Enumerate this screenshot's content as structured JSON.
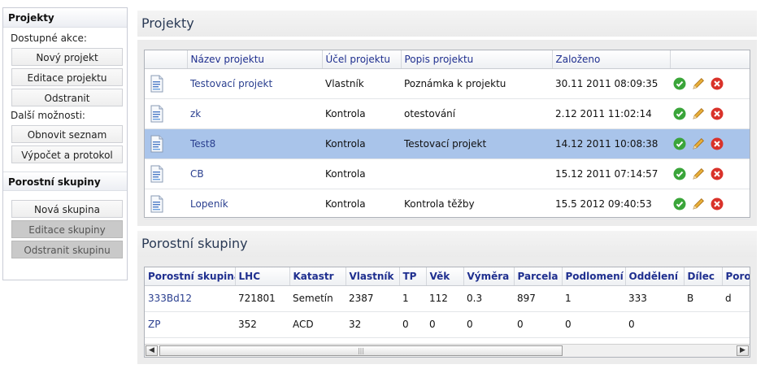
{
  "sidebar": {
    "section1_title": "Projekty",
    "available_actions_label": "Dostupné akce:",
    "btn_new_project": "Nový projekt",
    "btn_edit_project": "Editace projektu",
    "btn_remove": "Odstranit",
    "more_options_label": "Další možnosti:",
    "btn_refresh_list": "Obnovit seznam",
    "btn_calc_protocol": "Výpočet a protokol",
    "section2_title": "Porostní skupiny",
    "btn_new_group": "Nová skupina",
    "btn_edit_group": "Editace skupiny",
    "btn_remove_group": "Odstranit skupinu"
  },
  "projects": {
    "title": "Projekty",
    "columns": [
      "Název projektu",
      "Účel projektu",
      "Popis projektu",
      "Založeno"
    ],
    "rows": [
      {
        "name": "Testovací projekt",
        "purpose": "Vlastník",
        "description": "Poznámka k projektu",
        "created": "30.11 2011 08:09:35"
      },
      {
        "name": "zk",
        "purpose": "Kontrola",
        "description": "otestování",
        "created": "2.12 2011 11:02:14"
      },
      {
        "name": "Test8",
        "purpose": "Kontrola",
        "description": "Testovací projekt",
        "created": "14.12 2011 10:08:38"
      },
      {
        "name": "CB",
        "purpose": "Kontrola",
        "description": "",
        "created": "15.12 2011 07:14:57"
      },
      {
        "name": "Lopeník",
        "purpose": "Kontrola",
        "description": "Kontrola těžby",
        "created": "15.5 2012 09:40:53"
      }
    ],
    "selected_row": 2
  },
  "groups": {
    "title": "Porostní skupiny",
    "columns": [
      "Porostní skupina",
      "LHC",
      "Katastr",
      "Vlastník",
      "TP",
      "Věk",
      "Výměra",
      "Parcela",
      "Podlomení",
      "Oddělení",
      "Dílec",
      "Porost"
    ],
    "rows": [
      [
        "333Bd12",
        "721801",
        "Semetín",
        "2387",
        "1",
        "112",
        "0.3",
        "897",
        "1",
        "333",
        "B",
        "d"
      ],
      [
        "ZP",
        "352",
        "ACD",
        "32",
        "0",
        "0",
        "0",
        "0",
        "0",
        "0",
        "",
        ""
      ]
    ]
  },
  "colors": {
    "selected_row": "#a9c4ea",
    "header_link": "#1f2f8f",
    "accept": "#3aa53a",
    "delete": "#d9322a",
    "edit": "#e0a020"
  },
  "icons": {
    "row_icon": "document-icon",
    "actions": [
      "check-icon",
      "pencil-icon",
      "delete-icon"
    ]
  }
}
